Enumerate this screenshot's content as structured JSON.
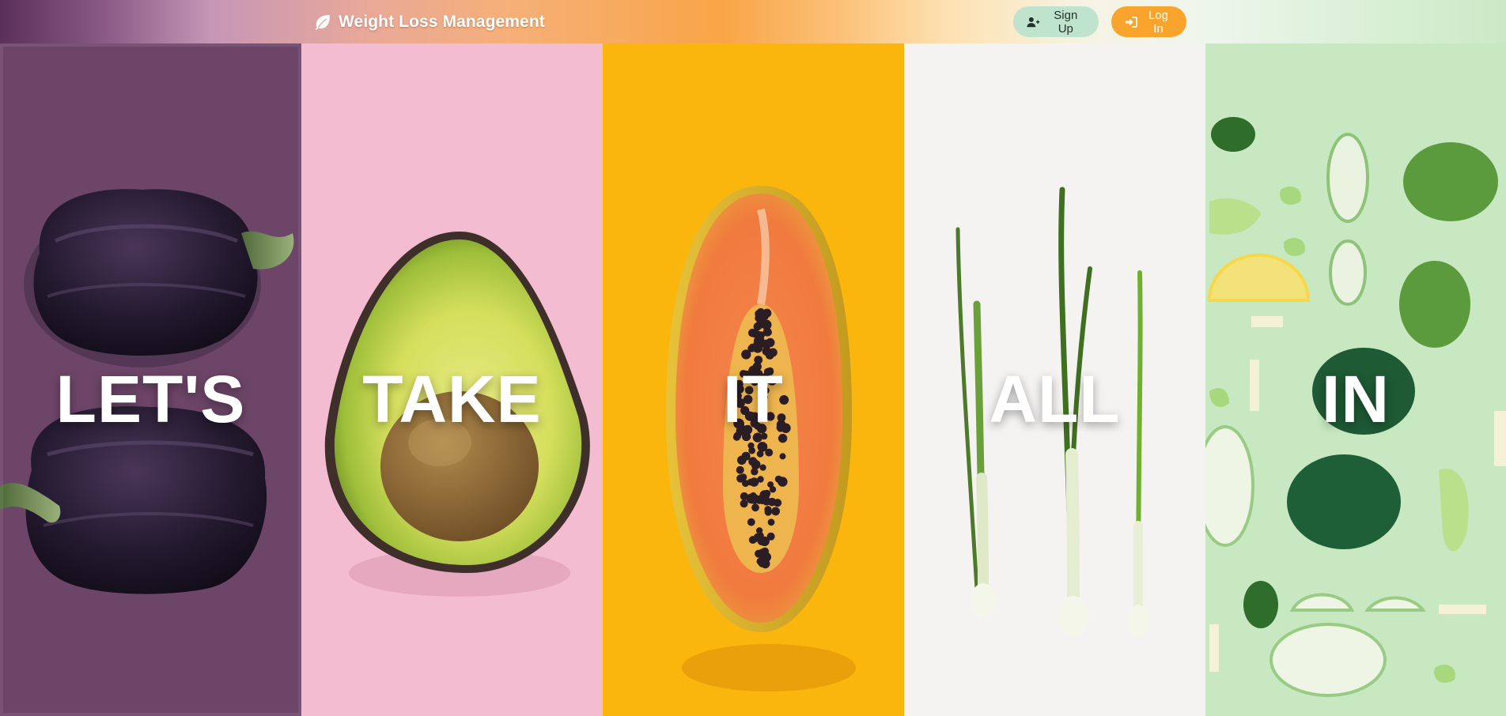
{
  "header": {
    "brand_label": "Weight Loss Management",
    "brand_icon": "leaf-icon",
    "signup_label": "Sign Up",
    "signup_icon": "user-plus-icon",
    "login_label": "Log In",
    "login_icon": "sign-in-icon",
    "colors": {
      "signup_bg": "#bfe3cc",
      "login_bg": "#f9a52d"
    }
  },
  "panels": [
    {
      "word": "LET'S",
      "image": "purple-bell-peppers",
      "bg": "#6d4568"
    },
    {
      "word": "TAKE",
      "image": "halved-avocado",
      "bg": "#f4bcd0"
    },
    {
      "word": "IT",
      "image": "halved-papaya",
      "bg": "#fbb60e"
    },
    {
      "word": "ALL",
      "image": "spring-onions",
      "bg": "#f5f3f2"
    },
    {
      "word": "IN",
      "image": "green-vegetables-flatlay",
      "bg": "#c7e8c1"
    }
  ]
}
